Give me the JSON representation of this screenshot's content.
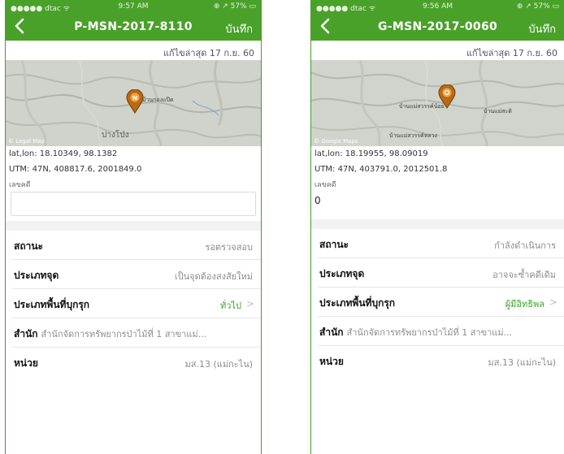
{
  "colors": {
    "accent": "#49a12a",
    "value_green": "#3aa324"
  },
  "screens": [
    {
      "status": {
        "carrier": "●●●●● dtac ᯤ",
        "time": "9:57 AM",
        "battery": "⊕ ↗ 57% ▭"
      },
      "nav": {
        "back_icon": "chevron-left-icon",
        "title": "P-MSN-2017-8110",
        "save": "บันทึก"
      },
      "updated": "แก้ไขล่าสุด 17 ก.ย. 60",
      "map": {
        "places": [
          "บ้านกองแป๊ด"
        ],
        "town": "ปางโป่ง",
        "legal": "© Legal Map"
      },
      "latlon": "lat,lon: 18.10349, 98.1382",
      "utm": "UTM: 47N, 408817.6, 2001849.0",
      "code_label": "เลขคดี",
      "code_value": "",
      "rows": {
        "status": {
          "label": "สถานะ",
          "value": "รอตรวจสอบ"
        },
        "point_type": {
          "label": "ประเภทจุด",
          "value": "เป็นจุดต้องสงสัยใหม่"
        },
        "area_type": {
          "label": "ประเภทพื้นที่บุกรุก",
          "value": "ทั่วไป"
        },
        "office": {
          "label": "สำนัก",
          "value": "สำนักจัดการทรัพยากรป่าไม้ที่ 1 สาขาแม่..."
        },
        "unit": {
          "label": "หน่วย",
          "value": "มส.13 (แม่กะไน)"
        }
      }
    },
    {
      "status": {
        "carrier": "●●●●● dtac ᯤ",
        "time": "9:56 AM",
        "battery": "⊕ ↗ 57% ▭"
      },
      "nav": {
        "back_icon": "chevron-left-icon",
        "title": "G-MSN-2017-0060",
        "save": "บันทึก"
      },
      "updated": "แก้ไขล่าสุด 17 ก.ย. 60",
      "map": {
        "places": [
          "บ้านแม่สวรรค์น้อย",
          "บ้านแม่สะดิ",
          "บ้านแม่สวรรค์หลวง"
        ],
        "legal": "© Google Maps"
      },
      "latlon": "lat,lon: 18.19955, 98.09019",
      "utm": "UTM: 47N, 403791.0, 2012501.8",
      "code_label": "เลขคดี",
      "code_value": "0",
      "rows": {
        "status": {
          "label": "สถานะ",
          "value": "กำลังดำเนินการ"
        },
        "point_type": {
          "label": "ประเภทจุด",
          "value": "อาจจะซ้ำคดีเดิม"
        },
        "area_type": {
          "label": "ประเภทพื้นที่บุกรุก",
          "value": "ผู้มีอิทธิพล"
        },
        "office": {
          "label": "สำนัก",
          "value": "สำนักจัดการทรัพยากรป่าไม้ที่ 1 สาขาแม่..."
        },
        "unit": {
          "label": "หน่วย",
          "value": "มส.13 (แม่กะไน)"
        }
      }
    }
  ]
}
